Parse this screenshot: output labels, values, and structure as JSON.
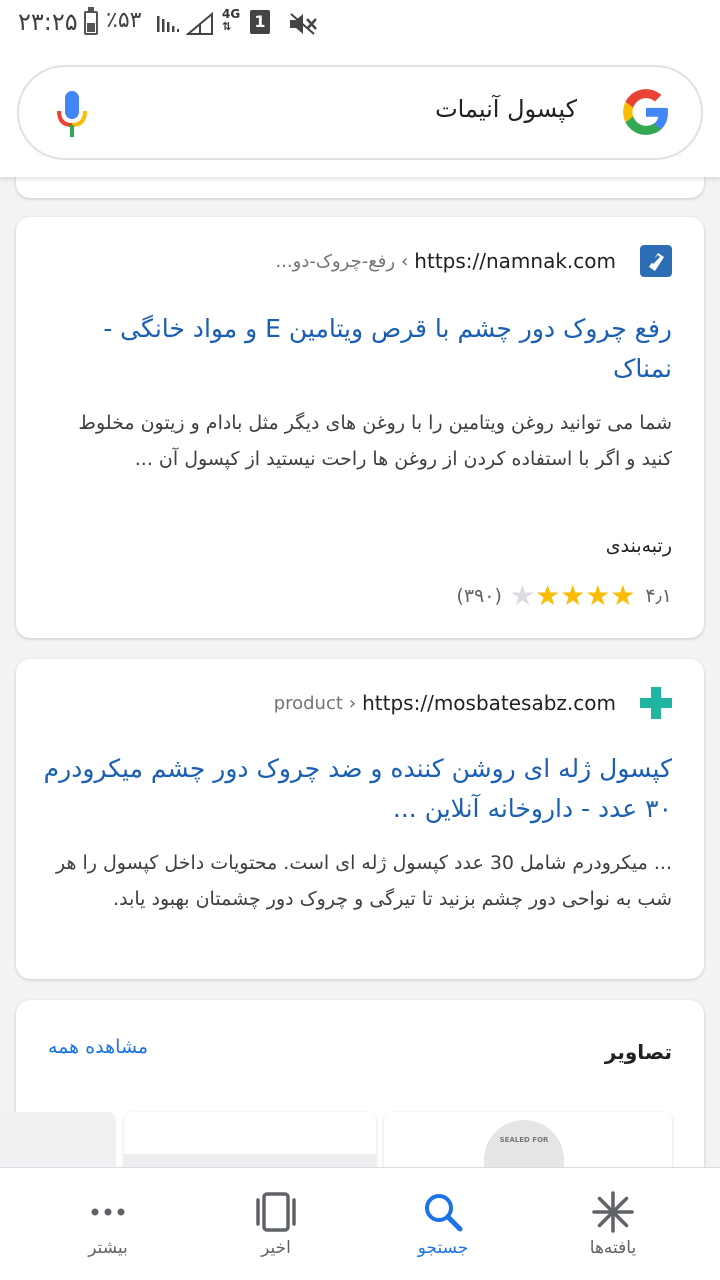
{
  "status_bar": {
    "time": "۲۳:۲۵",
    "battery": "٪۵۳",
    "network": "4G",
    "sim_slot": "1"
  },
  "search": {
    "query": "کپسول آنیمات"
  },
  "results": [
    {
      "url": "https://namnak.com",
      "path": "رفع-چروک-دو...",
      "favicon": "namnak-logo-icon",
      "title": "رفع چروک دور چشم با قرص ویتامین E و مواد خانگی - نمناک",
      "snippet": "شما می توانید روغن ویتامین را با روغن های دیگر مثل بادام و زیتون مخلوط کنید و اگر با استفاده کردن از روغن ها راحت نیستید از کپسول آن ...",
      "rating_label": "رتبه‌بندی",
      "rating_value": "۴٫۱",
      "rating_stars": 4,
      "rating_count": "(۳۹۰)"
    },
    {
      "url": "https://mosbatesabz.com",
      "path": "product",
      "favicon": "green-cross-icon",
      "title": "کپسول ژله ای روشن کننده و ضد چروک دور چشم میکرودرم ۳۰ عدد - داروخانه آنلاین ...",
      "snippet": "... میکرودرم شامل 30 عدد کپسول ژله ای است. محتویات داخل کپسول را هر شب به نواحی دور چشم بزنید تا تیرگی و چروک دور چشمتان بهبود یابد."
    }
  ],
  "images_section": {
    "heading": "تصاویر",
    "see_all": "مشاهده همه",
    "thumb_text": "SEALED FOR"
  },
  "bottom_nav": {
    "items": [
      {
        "label": "یافته‌ها",
        "icon": "asterisk-icon"
      },
      {
        "label": "جستجو",
        "icon": "search-icon",
        "active": true
      },
      {
        "label": "اخیر",
        "icon": "recent-tabs-icon"
      },
      {
        "label": "بیشتر",
        "icon": "more-dots-icon"
      }
    ]
  },
  "colors": {
    "link_blue": "#1a5fb4",
    "active_blue": "#1a73e8",
    "star_yellow": "#fbbc04",
    "favicon_green": "#1fb5a0"
  }
}
